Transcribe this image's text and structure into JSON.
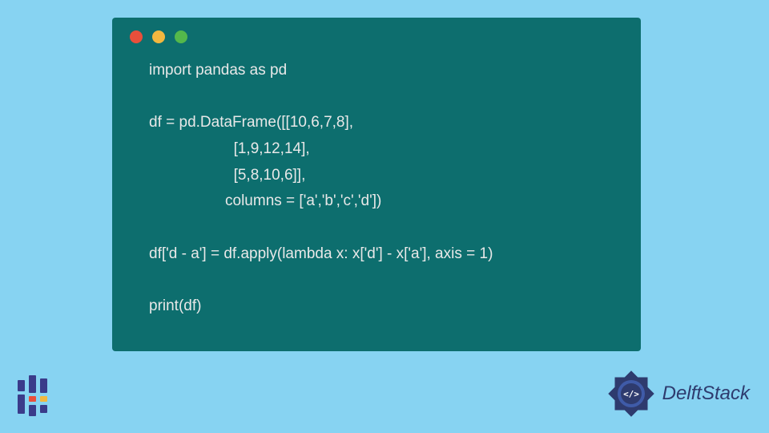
{
  "code": {
    "lines": [
      "import pandas as pd",
      "",
      "df = pd.DataFrame([[10,6,7,8],",
      "                    [1,9,12,14],",
      "                    [5,8,10,6]],",
      "                  columns = ['a','b','c','d'])",
      "",
      "df['d - a'] = df.apply(lambda x: x['d'] - x['a'], axis = 1)",
      "",
      "print(df)"
    ]
  },
  "brand": {
    "name": "DelftStack"
  },
  "window": {
    "controls": [
      "red",
      "yellow",
      "green"
    ]
  }
}
